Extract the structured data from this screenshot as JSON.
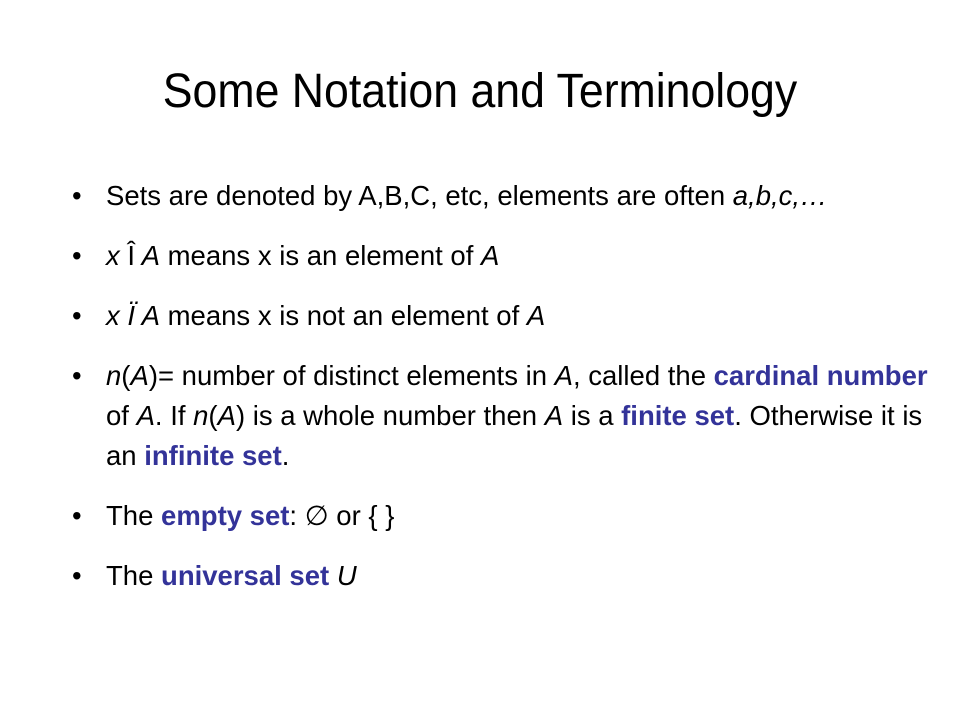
{
  "slide": {
    "title": "Some Notation and Terminology",
    "accent_color": "#333399",
    "bullet_glyph": "•",
    "bullets": [
      {
        "segments": [
          {
            "text": "Sets are denoted by A,B,C, etc, elements are often ",
            "style": "plain"
          },
          {
            "text": "a,b,c,…",
            "style": "italic"
          }
        ]
      },
      {
        "segments": [
          {
            "text": "x ",
            "style": "italic"
          },
          {
            "text": "Î",
            "style": "plain"
          },
          {
            "text": " A",
            "style": "italic"
          },
          {
            "text": " means x is an element of ",
            "style": "plain"
          },
          {
            "text": "A",
            "style": "italic"
          }
        ]
      },
      {
        "segments": [
          {
            "text": "x ",
            "style": "italic"
          },
          {
            "text": "Ï",
            "style": "italic"
          },
          {
            "text": " A",
            "style": "italic"
          },
          {
            "text": " means x is not an element of ",
            "style": "plain"
          },
          {
            "text": "A",
            "style": "italic"
          }
        ]
      },
      {
        "segments": [
          {
            "text": "n",
            "style": "italic"
          },
          {
            "text": "(",
            "style": "plain"
          },
          {
            "text": "A",
            "style": "italic"
          },
          {
            "text": ")= number of distinct elements in ",
            "style": "plain"
          },
          {
            "text": "A",
            "style": "italic"
          },
          {
            "text": ", called the ",
            "style": "plain"
          },
          {
            "text": "cardinal number",
            "style": "emphasis"
          },
          {
            "text": " of ",
            "style": "plain"
          },
          {
            "text": "A",
            "style": "italic"
          },
          {
            "text": ".  If ",
            "style": "plain"
          },
          {
            "text": "n",
            "style": "italic"
          },
          {
            "text": "(",
            "style": "plain"
          },
          {
            "text": "A",
            "style": "italic"
          },
          {
            "text": ") is a whole number then ",
            "style": "plain"
          },
          {
            "text": "A",
            "style": "italic"
          },
          {
            "text": " is a ",
            "style": "plain"
          },
          {
            "text": "finite set",
            "style": "emphasis"
          },
          {
            "text": ".  Otherwise it is an ",
            "style": "plain"
          },
          {
            "text": "infinite set",
            "style": "emphasis"
          },
          {
            "text": ".",
            "style": "plain"
          }
        ]
      },
      {
        "segments": [
          {
            "text": "The ",
            "style": "plain"
          },
          {
            "text": "empty set",
            "style": "emphasis"
          },
          {
            "text": ": ∅ or { }",
            "style": "plain"
          }
        ]
      },
      {
        "segments": [
          {
            "text": "The ",
            "style": "plain"
          },
          {
            "text": "universal set",
            "style": "emphasis"
          },
          {
            "text": " ",
            "style": "plain"
          },
          {
            "text": "U",
            "style": "italic"
          }
        ]
      }
    ]
  }
}
